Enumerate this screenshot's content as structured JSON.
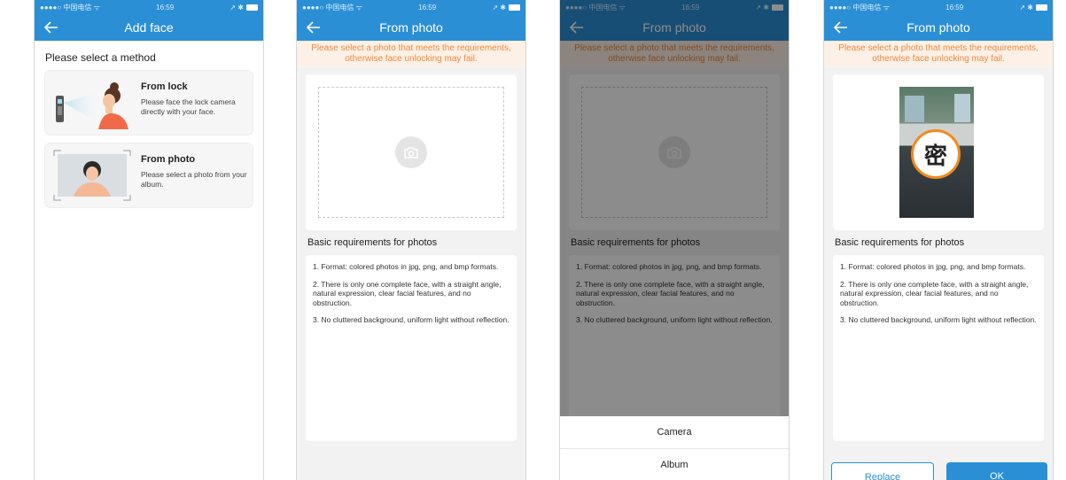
{
  "status": {
    "carrier": "●●●●○ 中国电信 ",
    "time": "16:59",
    "indicators": "↗ ✱"
  },
  "screen1": {
    "title": "Add face",
    "section_title": "Please select a method",
    "methods": [
      {
        "title": "From lock",
        "desc": "Please face the lock camera directly with your face."
      },
      {
        "title": "From photo",
        "desc": "Please select a photo from your album."
      }
    ]
  },
  "photo_screen": {
    "title": "From photo",
    "notice": "Please select a photo that meets the requirements, otherwise face unlocking may fail.",
    "req_title": "Basic requirements for photos",
    "requirements": [
      "1. Format: colored photos in jpg, png, and bmp formats.",
      "2. There is only one complete face, with a straight angle, natural expression, clear facial features, and no obstruction.",
      "3. No cluttered background, uniform light without reflection."
    ]
  },
  "sheet": {
    "camera": "Camera",
    "album": "Album"
  },
  "screen4": {
    "seal_text": "密",
    "replace": "Replace",
    "ok": "OK"
  },
  "colors": {
    "primary": "#2b8fd6",
    "notice_text": "#f0883a",
    "notice_bg": "#fdf1e7",
    "seal_ring": "#f28a1e"
  },
  "icons": {
    "back": "arrow-left-icon",
    "camera": "camera-icon",
    "battery": "battery-icon"
  }
}
